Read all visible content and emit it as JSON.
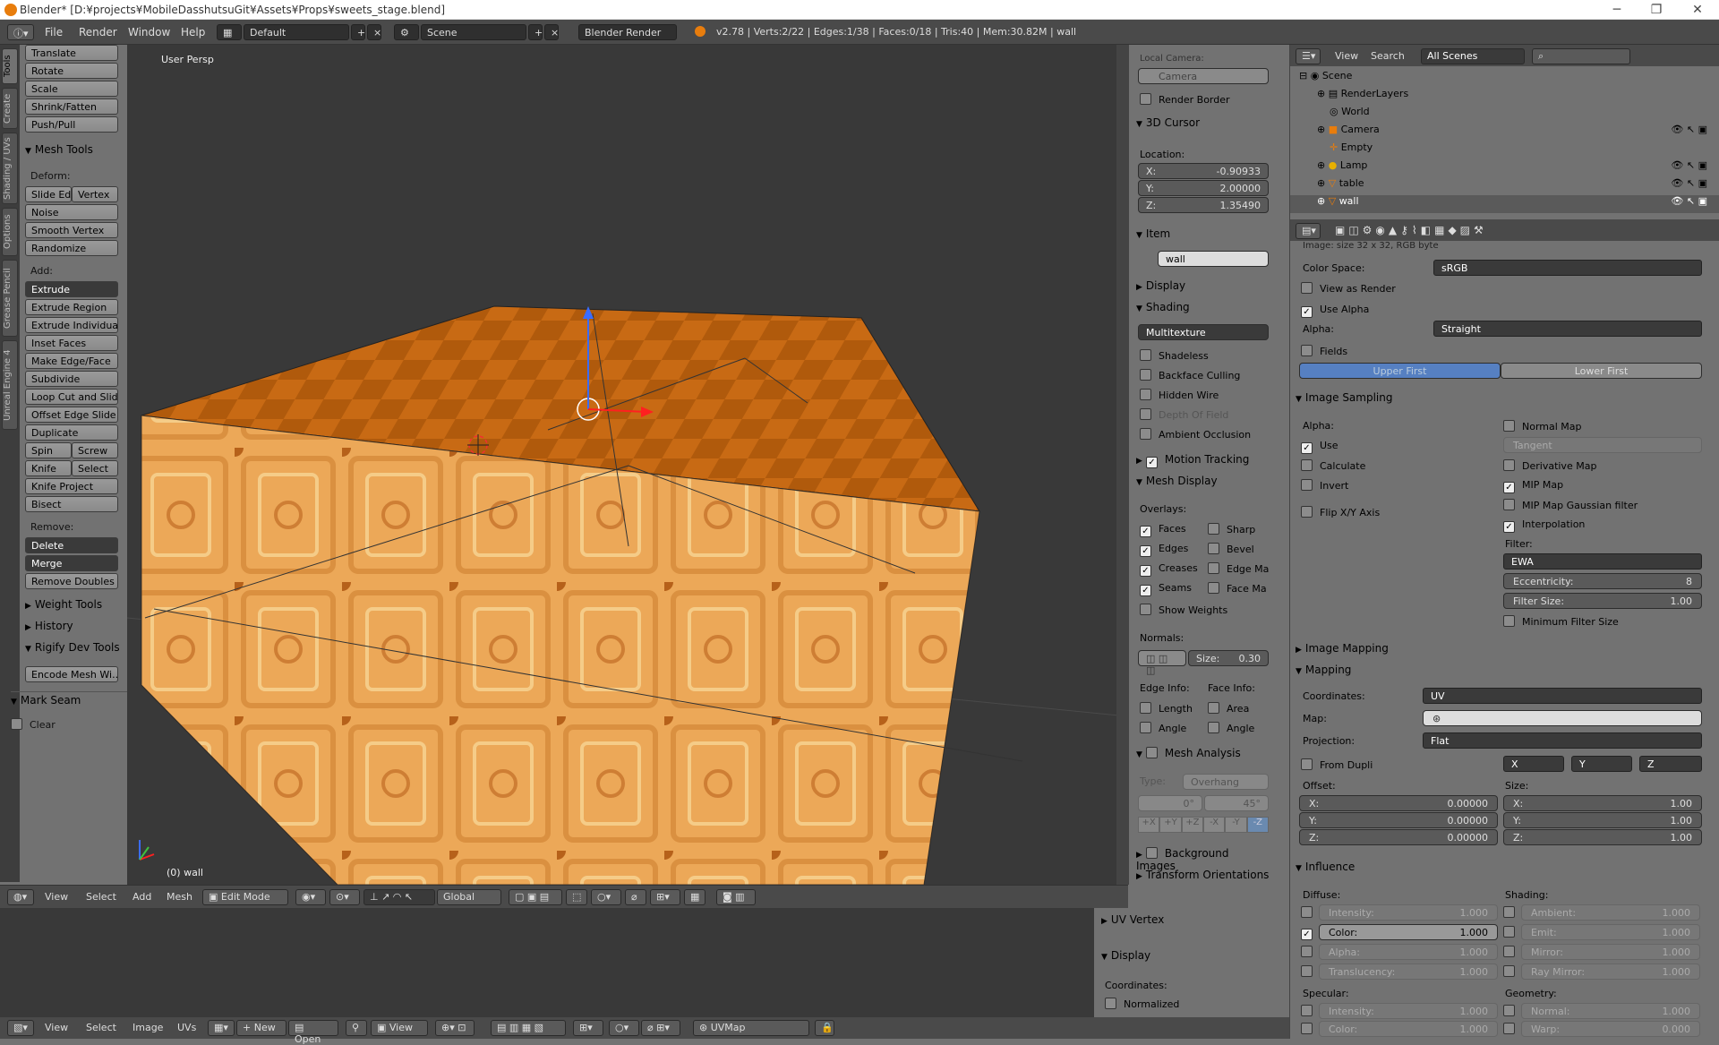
{
  "title": "Blender* [D:¥projects¥MobileDasshutsuGit¥Assets¥Props¥sweets_stage.blend]",
  "menus": [
    "File",
    "Render",
    "Window",
    "Help"
  ],
  "layout": "Default",
  "scene": "Scene",
  "engine": "Blender Render",
  "info": "v2.78 | Verts:2/22 | Edges:1/38 | Faces:0/18 | Tris:40 | Mem:30.82M | wall",
  "left_tabs": [
    "Tools",
    "Create",
    "Shading / UVs",
    "Options",
    "Grease Pencil",
    "Unreal Engine 4"
  ],
  "tools": {
    "transform": [
      "Translate",
      "Rotate",
      "Scale",
      "Shrink/Fatten",
      "Push/Pull"
    ],
    "mesh_tools": "Mesh Tools",
    "deform": "Deform:",
    "slide_edge": "Slide Ed",
    "vertex": "Vertex",
    "noise": "Noise",
    "smooth_vertex": "Smooth Vertex",
    "randomize": "Randomize",
    "add": "Add:",
    "extrude": "Extrude",
    "extrude_region": "Extrude Region",
    "extrude_individual": "Extrude Individual",
    "inset_faces": "Inset Faces",
    "make_edge_face": "Make Edge/Face",
    "subdivide": "Subdivide",
    "loop_cut": "Loop Cut and Slide",
    "offset_edge": "Offset Edge Slide",
    "duplicate": "Duplicate",
    "spin": "Spin",
    "screw": "Screw",
    "knife": "Knife",
    "select": "Select",
    "knife_project": "Knife Project",
    "bisect": "Bisect",
    "remove": "Remove:",
    "delete": "Delete",
    "merge": "Merge",
    "remove_doubles": "Remove Doubles",
    "weight_tools": "Weight Tools",
    "history": "History",
    "rigify": "Rigify Dev Tools",
    "encode": "Encode Mesh Wi...",
    "mark_seam": "Mark Seam",
    "clear": "Clear"
  },
  "viewport": {
    "label": "User Persp",
    "object": "(0) wall"
  },
  "npanel": {
    "local_camera": "Local Camera:",
    "camera": "Camera",
    "render_border": "Render Border",
    "cursor": "3D Cursor",
    "location": "Location:",
    "x": "-0.90933",
    "y": "2.00000",
    "z": "1.35490",
    "xl": "X:",
    "yl": "Y:",
    "zl": "Z:",
    "item": "Item",
    "item_name": "wall",
    "display": "Display",
    "shading": "Shading",
    "shading_mode": "Multitexture",
    "shadeless": "Shadeless",
    "backface": "Backface Culling",
    "hidden_wire": "Hidden Wire",
    "dof": "Depth Of Field",
    "ao": "Ambient Occlusion",
    "motion": "Motion Tracking",
    "mesh_display": "Mesh Display",
    "overlays": "Overlays:",
    "faces": "Faces",
    "sharp": "Sharp",
    "edges": "Edges",
    "bevel": "Bevel",
    "creases": "Creases",
    "edge_ma": "Edge Ma",
    "seams": "Seams",
    "face_ma": "Face Ma",
    "show_weights": "Show Weights",
    "normals": "Normals:",
    "size_label": "Size:",
    "size": "0.30",
    "edge_info": "Edge Info:",
    "face_info": "Face Info:",
    "length": "Length",
    "area": "Area",
    "angle": "Angle",
    "angle2": "Angle",
    "mesh_analysis": "Mesh Analysis",
    "type": "Type:",
    "overhang": "Overhang",
    "deg0": "0°",
    "deg45": "45°",
    "axes": [
      "+X",
      "+Y",
      "+Z",
      "-X",
      "-Y",
      "-Z"
    ],
    "background_images": "Background Images",
    "transform_orient": "Transform Orientations"
  },
  "outliner": {
    "view": "View",
    "search": "Search",
    "all_scenes": "All Scenes",
    "items": [
      "Scene",
      "RenderLayers",
      "World",
      "Camera",
      "Empty",
      "Lamp",
      "table",
      "wall"
    ]
  },
  "props": {
    "image_info": "Image: size 32 x 32, RGB byte",
    "color_space": "Color Space:",
    "color_space_val": "sRGB",
    "view_as_render": "View as Render",
    "use_alpha": "Use Alpha",
    "alpha": "Alpha:",
    "alpha_val": "Straight",
    "fields": "Fields",
    "upper_first": "Upper First",
    "lower_first": "Lower First",
    "image_sampling": "Image Sampling",
    "alpha2": "Alpha:",
    "use": "Use",
    "calculate": "Calculate",
    "invert": "Invert",
    "flip": "Flip X/Y Axis",
    "normal_map": "Normal Map",
    "tangent": "Tangent",
    "derivative": "Derivative Map",
    "mip_map": "MIP Map",
    "mip_gauss": "MIP Map Gaussian filter",
    "interpolation": "Interpolation",
    "filter": "Filter:",
    "filter_val": "EWA",
    "eccentricity": "Eccentricity:",
    "ecc_val": "8",
    "filter_size": "Filter Size:",
    "fs_val": "1.00",
    "min_filter": "Minimum Filter Size",
    "image_mapping": "Image Mapping",
    "mapping": "Mapping",
    "coordinates": "Coordinates:",
    "coord_val": "UV",
    "map": "Map:",
    "projection": "Projection:",
    "proj_val": "Flat",
    "from_dupli": "From Dupli",
    "px": "X",
    "py": "Y",
    "pz": "Z",
    "offset": "Offset:",
    "size": "Size:",
    "ox": "0.00000",
    "oy": "0.00000",
    "oz": "0.00000",
    "sx": "1.00",
    "sy": "1.00",
    "sz": "1.00",
    "xl": "X:",
    "yl": "Y:",
    "zl": "Z:",
    "influence": "Influence",
    "diffuse": "Diffuse:",
    "shading": "Shading:",
    "intensity": "Intensity:",
    "color": "Color:",
    "alpha3": "Alpha:",
    "translucency": "Translucency:",
    "ambient": "Ambient:",
    "emit": "Emit:",
    "mirror": "Mirror:",
    "ray_mirror": "Ray Mirror:",
    "one": "1.000",
    "specular": "Specular:",
    "geometry": "Geometry:",
    "intensity2": "Intensity:",
    "normal": "Normal:",
    "color2": "Color:",
    "warp": "Warp:",
    "zero": "0.000"
  },
  "vheader": {
    "view": "View",
    "select": "Select",
    "add": "Add",
    "mesh": "Mesh",
    "mode": "Edit Mode",
    "orientation": "Global"
  },
  "uvpanel": {
    "uv_vertex": "UV Vertex",
    "display": "Display",
    "coordinates": "Coordinates:",
    "normalized": "Normalized"
  },
  "uvheader": {
    "view": "View",
    "select": "Select",
    "image": "Image",
    "uvs": "UVs",
    "new": "New",
    "open": "Open",
    "view2": "View",
    "uvmap": "UVMap"
  }
}
